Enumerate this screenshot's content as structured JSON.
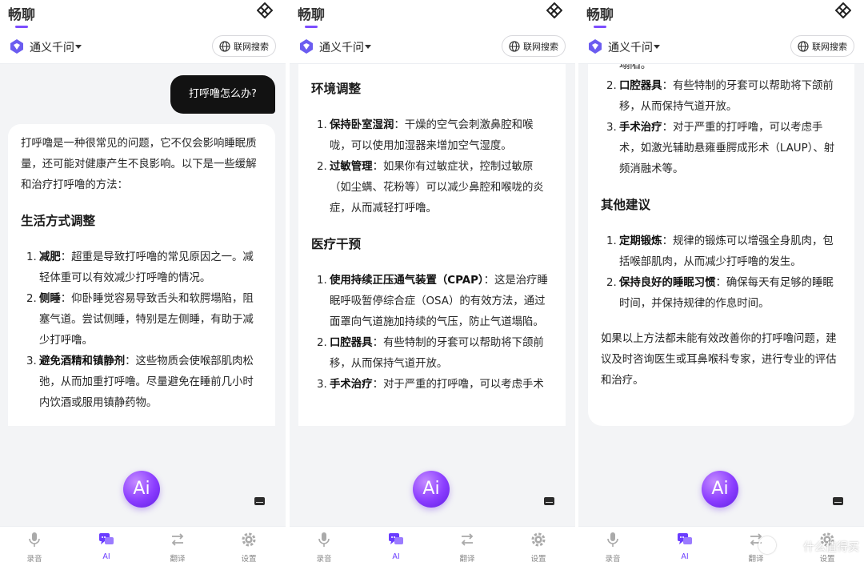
{
  "app_title": "畅聊",
  "model_name": "通义千问",
  "web_search_label": "联网搜索",
  "ai_button_label": "Ai",
  "nav": [
    {
      "label": "录音",
      "icon": "mic-icon"
    },
    {
      "label": "AI",
      "icon": "chat-icon"
    },
    {
      "label": "翻译",
      "icon": "swap-icon"
    },
    {
      "label": "设置",
      "icon": "gear-icon"
    }
  ],
  "colors": {
    "accent": "#6a3cff",
    "user_bubble": "#121212"
  },
  "screens": [
    {
      "user_message": "打呼噜怎么办?",
      "intro": "打呼噜是一种很常见的问题，它不仅会影响睡眠质量，还可能对健康产生不良影响。以下是一些缓解和治疗打呼噜的方法：",
      "sections": [
        {
          "heading": "生活方式调整",
          "items": [
            {
              "num": "1.",
              "term": "减肥",
              "text": "：超重是导致打呼噜的常见原因之一。减轻体重可以有效减少打呼噜的情况。"
            },
            {
              "num": "2.",
              "term": "侧睡",
              "text": "：仰卧睡觉容易导致舌头和软腭塌陷，阻塞气道。尝试侧睡，特别是左侧睡，有助于减少打呼噜。"
            },
            {
              "num": "3.",
              "term": "避免酒精和镇静剂",
              "text": "：这些物质会使喉部肌肉松弛，从而加重打呼噜。尽量避免在睡前几小时内饮酒或服用镇静药物。"
            }
          ]
        }
      ]
    },
    {
      "sections": [
        {
          "heading": "环境调整",
          "items": [
            {
              "num": "1.",
              "term": "保持卧室湿润",
              "text": "：干燥的空气会刺激鼻腔和喉咙，可以使用加湿器来增加空气湿度。"
            },
            {
              "num": "2.",
              "term": "过敏管理",
              "text": "：如果你有过敏症状，控制过敏原（如尘螨、花粉等）可以减少鼻腔和喉咙的炎症，从而减轻打呼噜。"
            }
          ]
        },
        {
          "heading": "医疗干预",
          "items": [
            {
              "num": "1.",
              "term": "使用持续正压通气装置（CPAP）",
              "text": "：这是治疗睡眠呼吸暂停综合症（OSA）的有效方法，通过面罩向气道施加持续的气压，防止气道塌陷。"
            },
            {
              "num": "2.",
              "term": "口腔器具",
              "text": "：有些特制的牙套可以帮助将下颌前移，从而保持气道开放。"
            },
            {
              "num": "3.",
              "term": "手术治疗",
              "text": "：对于严重的打呼噜，可以考虑手术"
            }
          ]
        }
      ]
    },
    {
      "sections": [
        {
          "heading": "",
          "items": [
            {
              "num": "",
              "term": "",
              "text": "塌陷。"
            },
            {
              "num": "2.",
              "term": "口腔器具",
              "text": "：有些特制的牙套可以帮助将下颌前移，从而保持气道开放。"
            },
            {
              "num": "3.",
              "term": "手术治疗",
              "text": "：对于严重的打呼噜，可以考虑手术，如激光辅助悬雍垂腭成形术（LAUP）、射频消融术等。"
            }
          ]
        },
        {
          "heading": "其他建议",
          "items": [
            {
              "num": "1.",
              "term": "定期锻炼",
              "text": "：规律的锻炼可以增强全身肌肉，包括喉部肌肉，从而减少打呼噜的发生。"
            },
            {
              "num": "2.",
              "term": "保持良好的睡眠习惯",
              "text": "：确保每天有足够的睡眠时间，并保持规律的作息时间。"
            }
          ]
        }
      ],
      "closing": "如果以上方法都未能有效改善你的打呼噜问题，建议及时咨询医生或耳鼻喉科专家，进行专业的评估和治疗。"
    }
  ],
  "watermark": "什么值得买"
}
